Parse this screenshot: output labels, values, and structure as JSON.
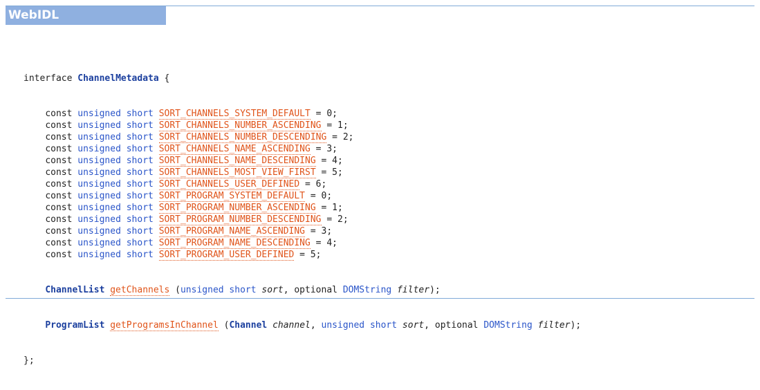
{
  "block_title": "WebIDL",
  "interface": {
    "keyword": "interface",
    "name": "ChannelMetadata",
    "open_brace": " {",
    "close": "};"
  },
  "const_keyword": "const",
  "const_type": "unsigned short",
  "constants": [
    {
      "name": "SORT_CHANNELS_SYSTEM_DEFAULT",
      "value": "0"
    },
    {
      "name": "SORT_CHANNELS_NUMBER_ASCENDING",
      "value": "1"
    },
    {
      "name": "SORT_CHANNELS_NUMBER_DESCENDING",
      "value": "2"
    },
    {
      "name": "SORT_CHANNELS_NAME_ASCENDING",
      "value": "3"
    },
    {
      "name": "SORT_CHANNELS_NAME_DESCENDING",
      "value": "4"
    },
    {
      "name": "SORT_CHANNELS_MOST_VIEW_FIRST",
      "value": "5"
    },
    {
      "name": "SORT_CHANNELS_USER_DEFINED",
      "value": "6"
    },
    {
      "name": "SORT_PROGRAM_SYSTEM_DEFAULT",
      "value": "0"
    },
    {
      "name": "SORT_PROGRAM_NUMBER_ASCENDING",
      "value": "1"
    },
    {
      "name": "SORT_PROGRAM_NUMBER_DESCENDING",
      "value": "2"
    },
    {
      "name": "SORT_PROGRAM_NAME_ASCENDING",
      "value": "3"
    },
    {
      "name": "SORT_PROGRAM_NAME_DESCENDING",
      "value": "4"
    },
    {
      "name": "SORT_PROGRAM_USER_DEFINED",
      "value": "5"
    }
  ],
  "methods": {
    "getChannels": {
      "return_type": "ChannelList",
      "name": "getChannels",
      "open_paren": " (",
      "p1_type": "unsigned short",
      "p1_name": "sort",
      "sep1": ", ",
      "optional": "optional",
      "p2_type": "DOMString",
      "p2_name": "filter",
      "close": ");"
    },
    "getProgramsInChannel": {
      "return_type": "ProgramList",
      "name": "getProgramsInChannel",
      "open_paren": " (",
      "p1_type": "Channel",
      "p1_name": "channel",
      "sep1": ", ",
      "p2_type": "unsigned short",
      "p2_name": "sort",
      "sep2": ", ",
      "optional": "optional",
      "p3_type": "DOMString",
      "p3_name": "filter",
      "close": ");"
    }
  },
  "colors": {
    "header_bg": "#8fb0e0",
    "rule": "#7fa9d8",
    "keyword": "#2a55c9",
    "type_ref": "#1b3f9e",
    "const_ref": "#e0541a"
  }
}
